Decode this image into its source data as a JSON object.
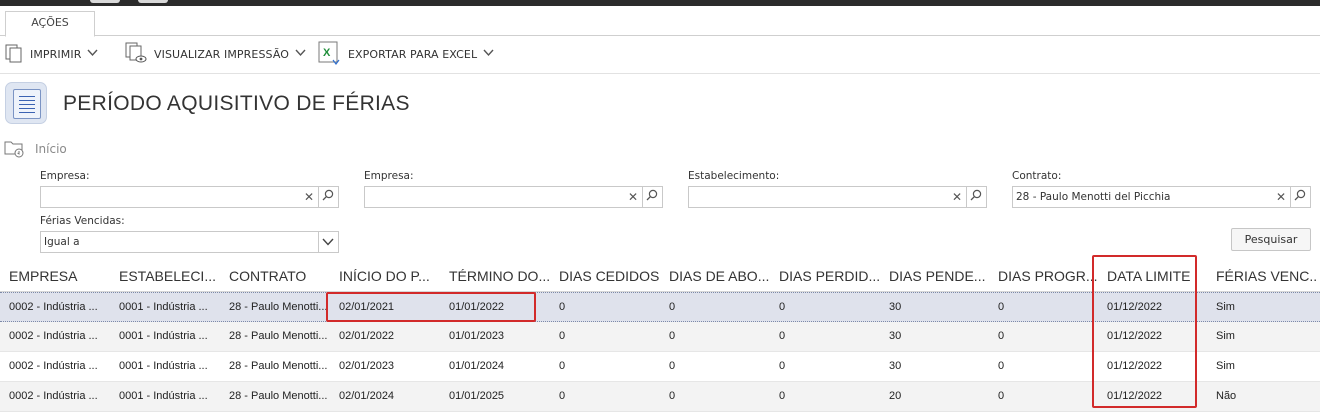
{
  "tabs": [
    {
      "label": "AÇÕES"
    }
  ],
  "toolbar": {
    "print_label": "IMPRIMIR",
    "preview_label": "VISUALIZAR IMPRESSÃO",
    "excel_label": "EXPORTAR PARA EXCEL",
    "chevron": "❯"
  },
  "page": {
    "title": "PERÍODO AQUISITIVO DE FÉRIAS"
  },
  "breadcrumb": {
    "label": "Início"
  },
  "filters": {
    "empresa1": {
      "label": "Empresa:",
      "value": ""
    },
    "empresa2": {
      "label": "Empresa:",
      "value": ""
    },
    "estabelecimento": {
      "label": "Estabelecimento:",
      "value": ""
    },
    "contrato": {
      "label": "Contrato:",
      "value": "28 - Paulo Menotti del Picchia"
    },
    "ferias_vencidas": {
      "label": "Férias Vencidas:",
      "value": "Igual a"
    }
  },
  "search_button": {
    "label": "Pesquisar"
  },
  "grid": {
    "headers": [
      "EMPRESA",
      "ESTABELECI...",
      "CONTRATO",
      "INÍCIO DO P...",
      "TÉRMINO DO...",
      "DIAS CEDIDOS",
      "DIAS DE ABO...",
      "DIAS PERDID...",
      "DIAS PENDE...",
      "DIAS PROGR...",
      "DATA LIMITE",
      "FÉRIAS VENC..."
    ],
    "rows": [
      [
        "0002 - Indústria ...",
        "0001 - Indústria ...",
        "28 - Paulo Menotti...",
        "02/01/2021",
        "01/01/2022",
        "0",
        "0",
        "0",
        "30",
        "0",
        "01/12/2022",
        "Sim"
      ],
      [
        "0002 - Indústria ...",
        "0001 - Indústria ...",
        "28 - Paulo Menotti...",
        "02/01/2022",
        "01/01/2023",
        "0",
        "0",
        "0",
        "30",
        "0",
        "01/12/2022",
        "Sim"
      ],
      [
        "0002 - Indústria ...",
        "0001 - Indústria ...",
        "28 - Paulo Menotti...",
        "02/01/2023",
        "01/01/2024",
        "0",
        "0",
        "0",
        "30",
        "0",
        "01/12/2022",
        "Sim"
      ],
      [
        "0002 - Indústria ...",
        "0001 - Indústria ...",
        "28 - Paulo Menotti...",
        "02/01/2024",
        "01/01/2025",
        "0",
        "0",
        "0",
        "20",
        "0",
        "01/12/2022",
        "Não"
      ]
    ]
  },
  "icons": {
    "print": "print-icon",
    "preview": "print-preview-icon",
    "excel": "excel-icon",
    "page": "document-list-icon",
    "breadcrumb": "folder-home-icon",
    "clear": "clear-icon",
    "search": "search-icon",
    "dropdown": "chevron-down-icon"
  },
  "colors": {
    "highlight": "#d22a2a",
    "selected_row": "#dfe2ec",
    "excel_green": "#1f8f3a"
  }
}
